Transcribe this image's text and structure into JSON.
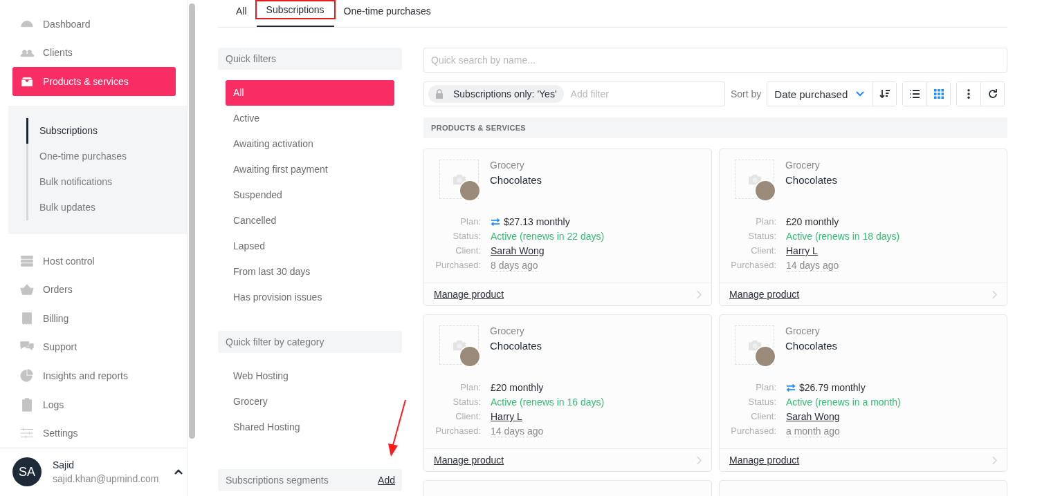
{
  "sidebar": {
    "items": [
      {
        "label": "Dashboard",
        "selected": false
      },
      {
        "label": "Clients",
        "selected": false
      },
      {
        "label": "Products & services",
        "selected": true,
        "children": [
          {
            "label": "Subscriptions",
            "selected": true
          },
          {
            "label": "One-time purchases",
            "selected": false
          },
          {
            "label": "Bulk notifications",
            "selected": false
          },
          {
            "label": "Bulk updates",
            "selected": false
          }
        ]
      },
      {
        "label": "Host control",
        "selected": false
      },
      {
        "label": "Orders",
        "selected": false
      },
      {
        "label": "Billing",
        "selected": false
      },
      {
        "label": "Support",
        "selected": false
      },
      {
        "label": "Insights and reports",
        "selected": false
      },
      {
        "label": "Logs",
        "selected": false
      },
      {
        "label": "Settings",
        "selected": false
      }
    ],
    "user": {
      "initials": "SA",
      "name": "Sajid",
      "email": "sajid.khan@upmind.com"
    }
  },
  "tabs": [
    {
      "label": "All",
      "selected": false,
      "highlighted": false
    },
    {
      "label": "Subscriptions",
      "selected": true,
      "highlighted": true
    },
    {
      "label": "One-time purchases",
      "selected": false,
      "highlighted": false
    }
  ],
  "quick_filters": {
    "title": "Quick filters",
    "items": [
      {
        "label": "All",
        "selected": true
      },
      {
        "label": "Active",
        "selected": false
      },
      {
        "label": "Awaiting activation",
        "selected": false
      },
      {
        "label": "Awaiting first payment",
        "selected": false
      },
      {
        "label": "Suspended",
        "selected": false
      },
      {
        "label": "Cancelled",
        "selected": false
      },
      {
        "label": "Lapsed",
        "selected": false
      },
      {
        "label": "From last 30 days",
        "selected": false
      },
      {
        "label": "Has provision issues",
        "selected": false
      }
    ]
  },
  "category_filters": {
    "title": "Quick filter by category",
    "items": [
      {
        "label": "Web Hosting",
        "selected": false
      },
      {
        "label": "Grocery",
        "selected": false
      },
      {
        "label": "Shared Hosting",
        "selected": false
      }
    ]
  },
  "segments": {
    "title": "Subscriptions segments",
    "action": "Add"
  },
  "search": {
    "placeholder": "Quick search by name..."
  },
  "filter_bar": {
    "chip": "Subscriptions only: 'Yes'",
    "placeholder": "Add filter",
    "sort_label": "Sort by",
    "sort_value": "Date purchased",
    "grid_view": true
  },
  "section_title": "PRODUCTS & SERVICES",
  "cards": [
    {
      "category": "Grocery",
      "name": "Chocolates",
      "plan_label": "Plan:",
      "plan": "$27.13 monthly",
      "recurring_icon": true,
      "status_label": "Status:",
      "status": "Active (renews in 22 days)",
      "client_label": "Client:",
      "client": "Sarah Wong",
      "purchased_label": "Purchased:",
      "purchased": "8 days ago",
      "action": "Manage product"
    },
    {
      "category": "Grocery",
      "name": "Chocolates",
      "plan_label": "Plan:",
      "plan": "£20 monthly",
      "recurring_icon": false,
      "status_label": "Status:",
      "status": "Active (renews in 18 days)",
      "client_label": "Client:",
      "client": "Harry L",
      "purchased_label": "Purchased:",
      "purchased": "14 days ago",
      "action": "Manage product"
    },
    {
      "category": "Grocery",
      "name": "Chocolates",
      "plan_label": "Plan:",
      "plan": "£20 monthly",
      "recurring_icon": false,
      "status_label": "Status:",
      "status": "Active (renews in 16 days)",
      "client_label": "Client:",
      "client": "Harry L",
      "purchased_label": "Purchased:",
      "purchased": "14 days ago",
      "action": "Manage product"
    },
    {
      "category": "Grocery",
      "name": "Chocolates",
      "plan_label": "Plan:",
      "plan": "$26.79 monthly",
      "recurring_icon": true,
      "status_label": "Status:",
      "status": "Active (renews in a month)",
      "client_label": "Client:",
      "client": "Sarah Wong",
      "purchased_label": "Purchased:",
      "purchased": "a month ago",
      "action": "Manage product"
    }
  ],
  "annotation_arrow": true
}
